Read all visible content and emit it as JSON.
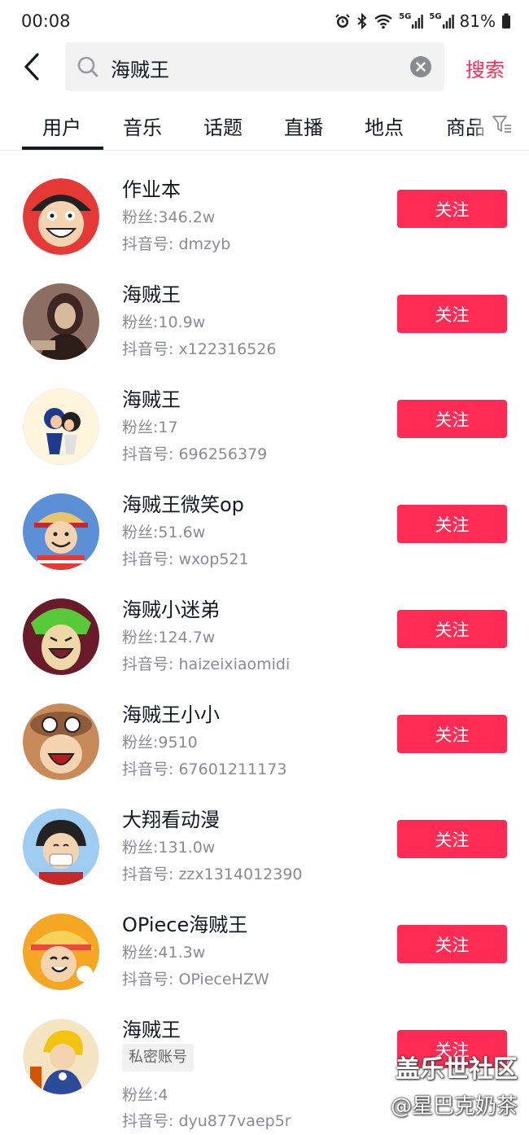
{
  "status_bar": {
    "time": "00:08",
    "network_1": "5G",
    "network_2": "5G",
    "battery": "81%"
  },
  "search": {
    "query": "海贼王",
    "submit_label": "搜索"
  },
  "tabs": [
    "用户",
    "音乐",
    "话题",
    "直播",
    "地点",
    "商品"
  ],
  "follow_label": "关注",
  "users": [
    {
      "name": "作业本",
      "fans": "粉丝:346.2w",
      "douyin_id": "抖音号: dmzyb",
      "avatar_colors": [
        "#e53935",
        "#ffffff",
        "#222222"
      ]
    },
    {
      "name": "海贼王",
      "fans": "粉丝:10.9w",
      "douyin_id": "抖音号: x122316526",
      "avatar_colors": [
        "#8d6e63",
        "#3e2723",
        "#d7b99b"
      ]
    },
    {
      "name": "海贼王",
      "fans": "粉丝:17",
      "douyin_id": "抖音号: 696256379",
      "avatar_colors": [
        "#fdf6dc",
        "#1e3a8a",
        "#f8c9a0"
      ]
    },
    {
      "name": "海贼王微笑op",
      "fans": "粉丝:51.6w",
      "douyin_id": "抖音号: wxop521",
      "avatar_colors": [
        "#5b8fd6",
        "#e53935",
        "#222222"
      ]
    },
    {
      "name": "海贼小迷弟",
      "fans": "粉丝:124.7w",
      "douyin_id": "抖音号: haizeixiaomidi",
      "avatar_colors": [
        "#6a1b2a",
        "#58c93a",
        "#f0d7a8"
      ]
    },
    {
      "name": "海贼王小小",
      "fans": "粉丝:9510",
      "douyin_id": "抖音号: 67601211173",
      "avatar_colors": [
        "#c98a5a",
        "#8d5a3a",
        "#ffffff"
      ]
    },
    {
      "name": "大翔看动漫",
      "fans": "粉丝:131.0w",
      "douyin_id": "抖音号: zzx1314012390",
      "avatar_colors": [
        "#9fcdf2",
        "#c62828",
        "#222222"
      ]
    },
    {
      "name": "OPiece海贼王",
      "fans": "粉丝:41.3w",
      "douyin_id": "抖音号: OPieceHZW",
      "avatar_colors": [
        "#f5a623",
        "#e74c3c",
        "#222222"
      ]
    },
    {
      "name": "海贼王",
      "private_tag": "私密账号",
      "fans": "粉丝:4",
      "douyin_id": "抖音号: dyu877vaep5r",
      "avatar_colors": [
        "#f4e4c1",
        "#2c4a9a",
        "#f1c40f"
      ]
    }
  ],
  "watermark": {
    "line1": "盖乐世社区",
    "line2": "@星巴克奶茶"
  },
  "colors": {
    "accent": "#fe2c55",
    "text_primary": "#161823",
    "text_secondary": "#8a8b91"
  }
}
